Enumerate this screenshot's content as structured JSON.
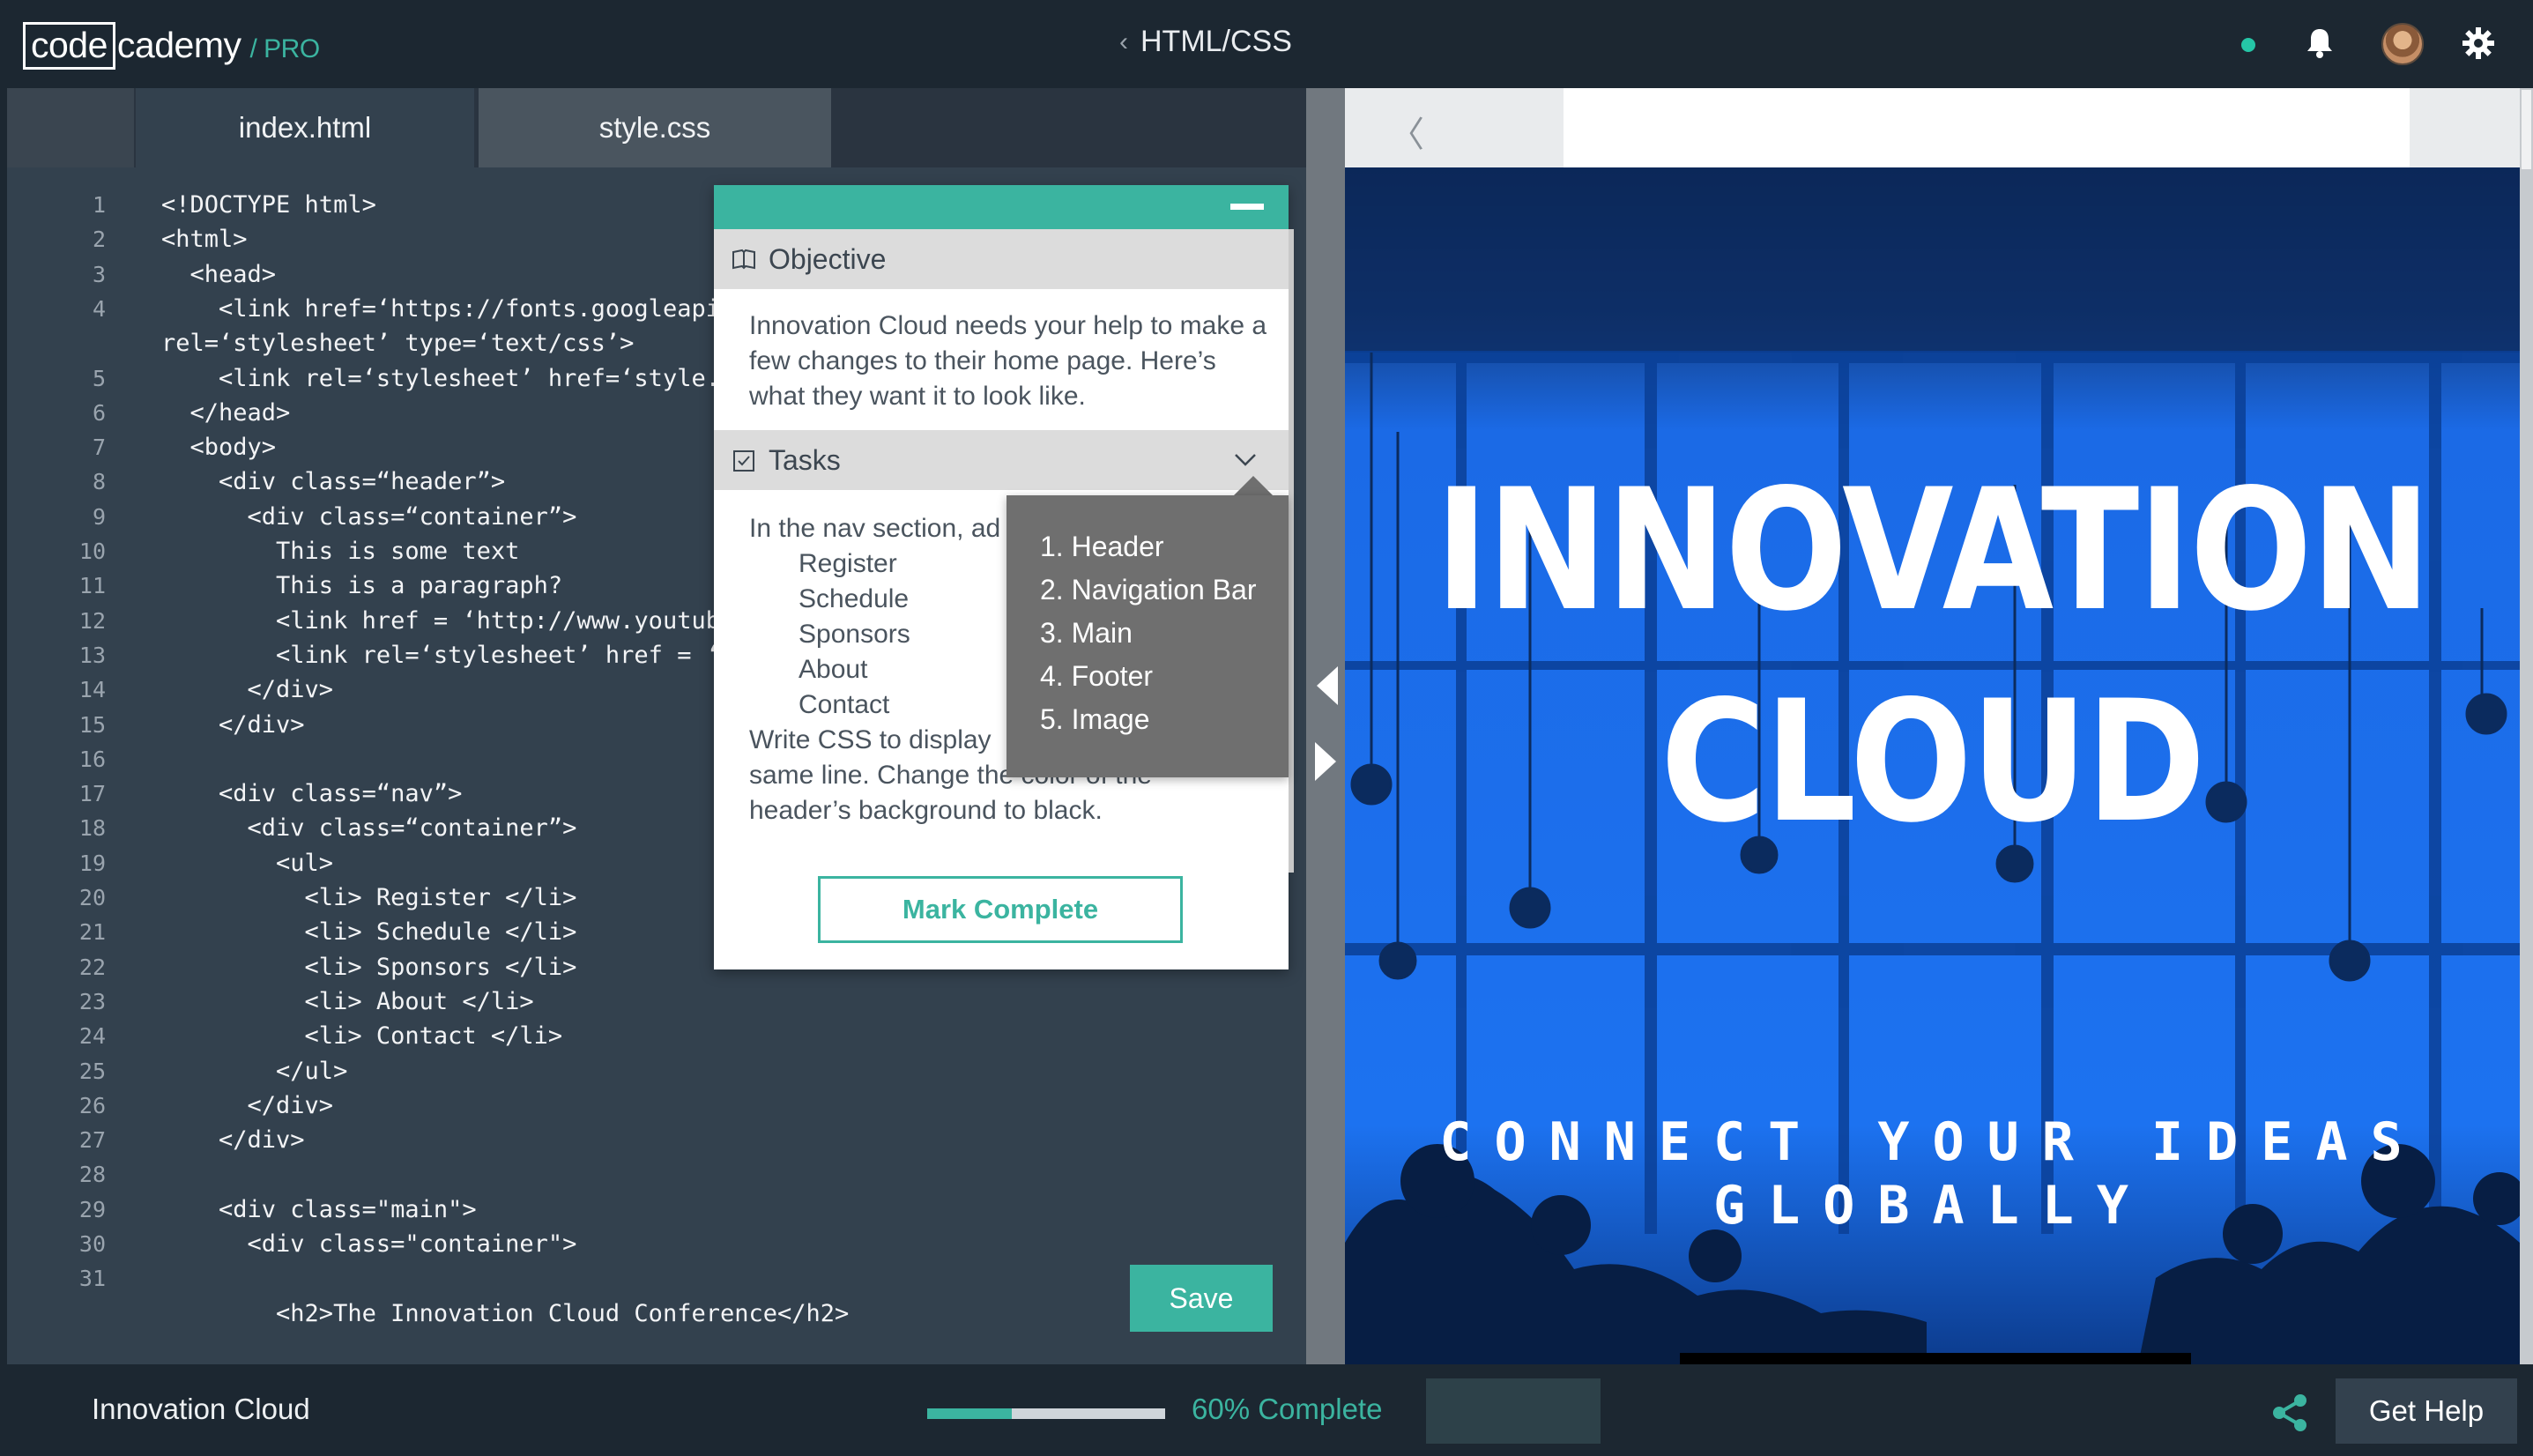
{
  "app": {
    "logo_code": "code",
    "logo_cademy": "cademy",
    "logo_pro": "/ PRO",
    "course_title": "HTML/CSS",
    "back_chevron": "‹"
  },
  "editor": {
    "tabs": [
      {
        "label": "index.html",
        "active": true
      },
      {
        "label": "style.css",
        "active": false
      }
    ],
    "lines": [
      {
        "n": "1",
        "text": "<!DOCTYPE html>"
      },
      {
        "n": "2",
        "text": "<html>"
      },
      {
        "n": "3",
        "text": "  <head>"
      },
      {
        "n": "4",
        "text": "    <link href=‘https://fonts.googleapis"
      },
      {
        "n": "",
        "text": "rel=‘stylesheet’ type=‘text/css’>"
      },
      {
        "n": "5",
        "text": "    <link rel=‘stylesheet’ href=‘style.c"
      },
      {
        "n": "6",
        "text": "  </head>"
      },
      {
        "n": "7",
        "text": "  <body>"
      },
      {
        "n": "8",
        "text": "    <div class=“header”>"
      },
      {
        "n": "9",
        "text": "      <div class=“container”>"
      },
      {
        "n": "10",
        "text": "        This is some text"
      },
      {
        "n": "11",
        "text": "        This is a paragraph?"
      },
      {
        "n": "12",
        "text": "        <link href = ‘http://www.youtube"
      },
      {
        "n": "13",
        "text": "        <link rel=‘stylesheet’ href = ‘s"
      },
      {
        "n": "14",
        "text": "      </div>"
      },
      {
        "n": "15",
        "text": "    </div>"
      },
      {
        "n": "16",
        "text": ""
      },
      {
        "n": "17",
        "text": "    <div class=“nav”>"
      },
      {
        "n": "18",
        "text": "      <div class=“container”>"
      },
      {
        "n": "19",
        "text": "        <ul>"
      },
      {
        "n": "20",
        "text": "          <li> Register </li>"
      },
      {
        "n": "21",
        "text": "          <li> Schedule </li>"
      },
      {
        "n": "22",
        "text": "          <li> Sponsors </li>"
      },
      {
        "n": "23",
        "text": "          <li> About </li>"
      },
      {
        "n": "24",
        "text": "          <li> Contact </li>"
      },
      {
        "n": "25",
        "text": "        </ul>"
      },
      {
        "n": "26",
        "text": "      </div>"
      },
      {
        "n": "27",
        "text": "    </div>"
      },
      {
        "n": "28",
        "text": ""
      },
      {
        "n": "29",
        "text": "    <div class=\"main\">"
      },
      {
        "n": "30",
        "text": "      <div class=\"container\">"
      },
      {
        "n": "31",
        "text": ""
      },
      {
        "n": "",
        "text": "        <h2>The Innovation Cloud Conference</h2>"
      }
    ],
    "save_label": "Save"
  },
  "lesson": {
    "objective_label": "Objective",
    "objective_text": "Innovation Cloud needs your help to make a few changes to their home page. Here’s what they want it to look like.",
    "tasks_label": "Tasks",
    "tasks_intro": "In the nav section, ad",
    "tasks_items": [
      "Register",
      "Schedule",
      "Sponsors",
      "About",
      "Contact"
    ],
    "tasks_outro_1": "Write CSS to display",
    "tasks_outro_2": "same line. Change the color of the",
    "tasks_outro_3": "header’s background to black.",
    "mark_complete_label": "Mark Complete",
    "dropdown_items": [
      "1. Header",
      "2. Navigation Bar",
      "3. Main",
      "4. Footer",
      "5. Image"
    ]
  },
  "preview": {
    "back_chevron": "〈",
    "hero_line1": "INNOVATION",
    "hero_line2": "CLOUD",
    "hero_sub_line1": "CONNECT YOUR IDEAS",
    "hero_sub_line2": "GLOBALLY"
  },
  "footer": {
    "project_name": "Innovation Cloud",
    "progress_percent": 60,
    "progress_label": "60% Complete",
    "help_label": "Get Help"
  },
  "colors": {
    "accent": "#3bb4a0",
    "topbar": "#1c2731",
    "editor_bg": "#33414e",
    "hero_blue": "#1a6fe8"
  },
  "icons": {
    "status": "online-dot",
    "notifications": "bell-icon",
    "settings": "gear-icon",
    "share": "share-icon",
    "objective": "book-icon",
    "tasks": "checkbox-icon"
  }
}
